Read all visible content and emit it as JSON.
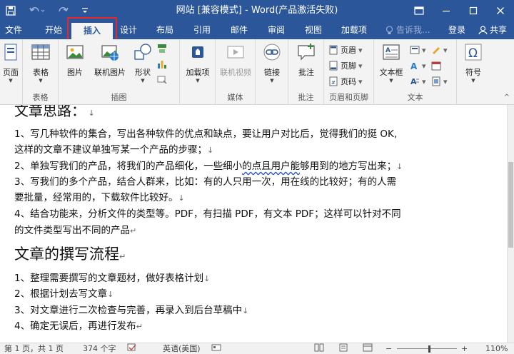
{
  "window": {
    "title": "网站 [兼容模式] - Word(产品激活失败)",
    "colors": {
      "brand": "#2b579a",
      "highlight": "#e8262b"
    }
  },
  "tabs": [
    {
      "label": "文件"
    },
    {
      "label": "开始"
    },
    {
      "label": "插入"
    },
    {
      "label": "设计"
    },
    {
      "label": "布局"
    },
    {
      "label": "引用"
    },
    {
      "label": "邮件"
    },
    {
      "label": "审阅"
    },
    {
      "label": "视图"
    },
    {
      "label": "加载项"
    }
  ],
  "tell_me": "告诉我...",
  "login": "登录",
  "share": "共享",
  "ribbon": {
    "page": "页面",
    "table": "表格",
    "table_group": "表格",
    "picture": "图片",
    "online_picture": "联机图片",
    "shapes": "形状",
    "illustrations_group": "插图",
    "addins": "加载项",
    "online_video": "联机视频",
    "media_group": "媒体",
    "link": "链接",
    "comment": "批注",
    "comments_group": "批注",
    "header": "页眉",
    "footer": "页脚",
    "page_number": "页码",
    "header_footer_group": "页眉和页脚",
    "textbox": "文本框",
    "text_group": "文本",
    "symbol": "符号"
  },
  "document": {
    "heading1": "文章思路：",
    "p1a": "1、写几种软件的集合，写出各种软件的优点和缺点，要让用户对比后，觉得我们的挺 OK,",
    "p1b": "这样的文章不建议单独写某一个产品的步骤；",
    "p2_pre": "2、单独写我们的产品，将我们的产品细化，一些细小",
    "p2_sq": "的点且用户能",
    "p2_post": "够用到的地方写出来；",
    "p3a": "3、写我们的多个产品，结合人群来，比如：有的人只用一次，用在线的比较好；有的人需",
    "p3b": "要批量，经常用的，下载软件比较好。",
    "p4a": "4、结合功能来，分析文件的类型等。PDF，有扫描 PDF，有文本 PDF；这样可以针对不同",
    "p4b": "的文件类型写出不同的产品",
    "heading2": "文章的撰写流程",
    "s1": "1、整理需要撰写的文章题材，做好表格计划",
    "s2": "2、根据计划去写文章",
    "s3": "3、对文章进行二次检查与完善，再录入到后台草稿中",
    "s4": "4、确定无误后，再进行发布"
  },
  "status": {
    "page": "第 1 页，共 1 页",
    "words": "374 个字",
    "lang": "英语(美国)",
    "zoom": "110%"
  }
}
